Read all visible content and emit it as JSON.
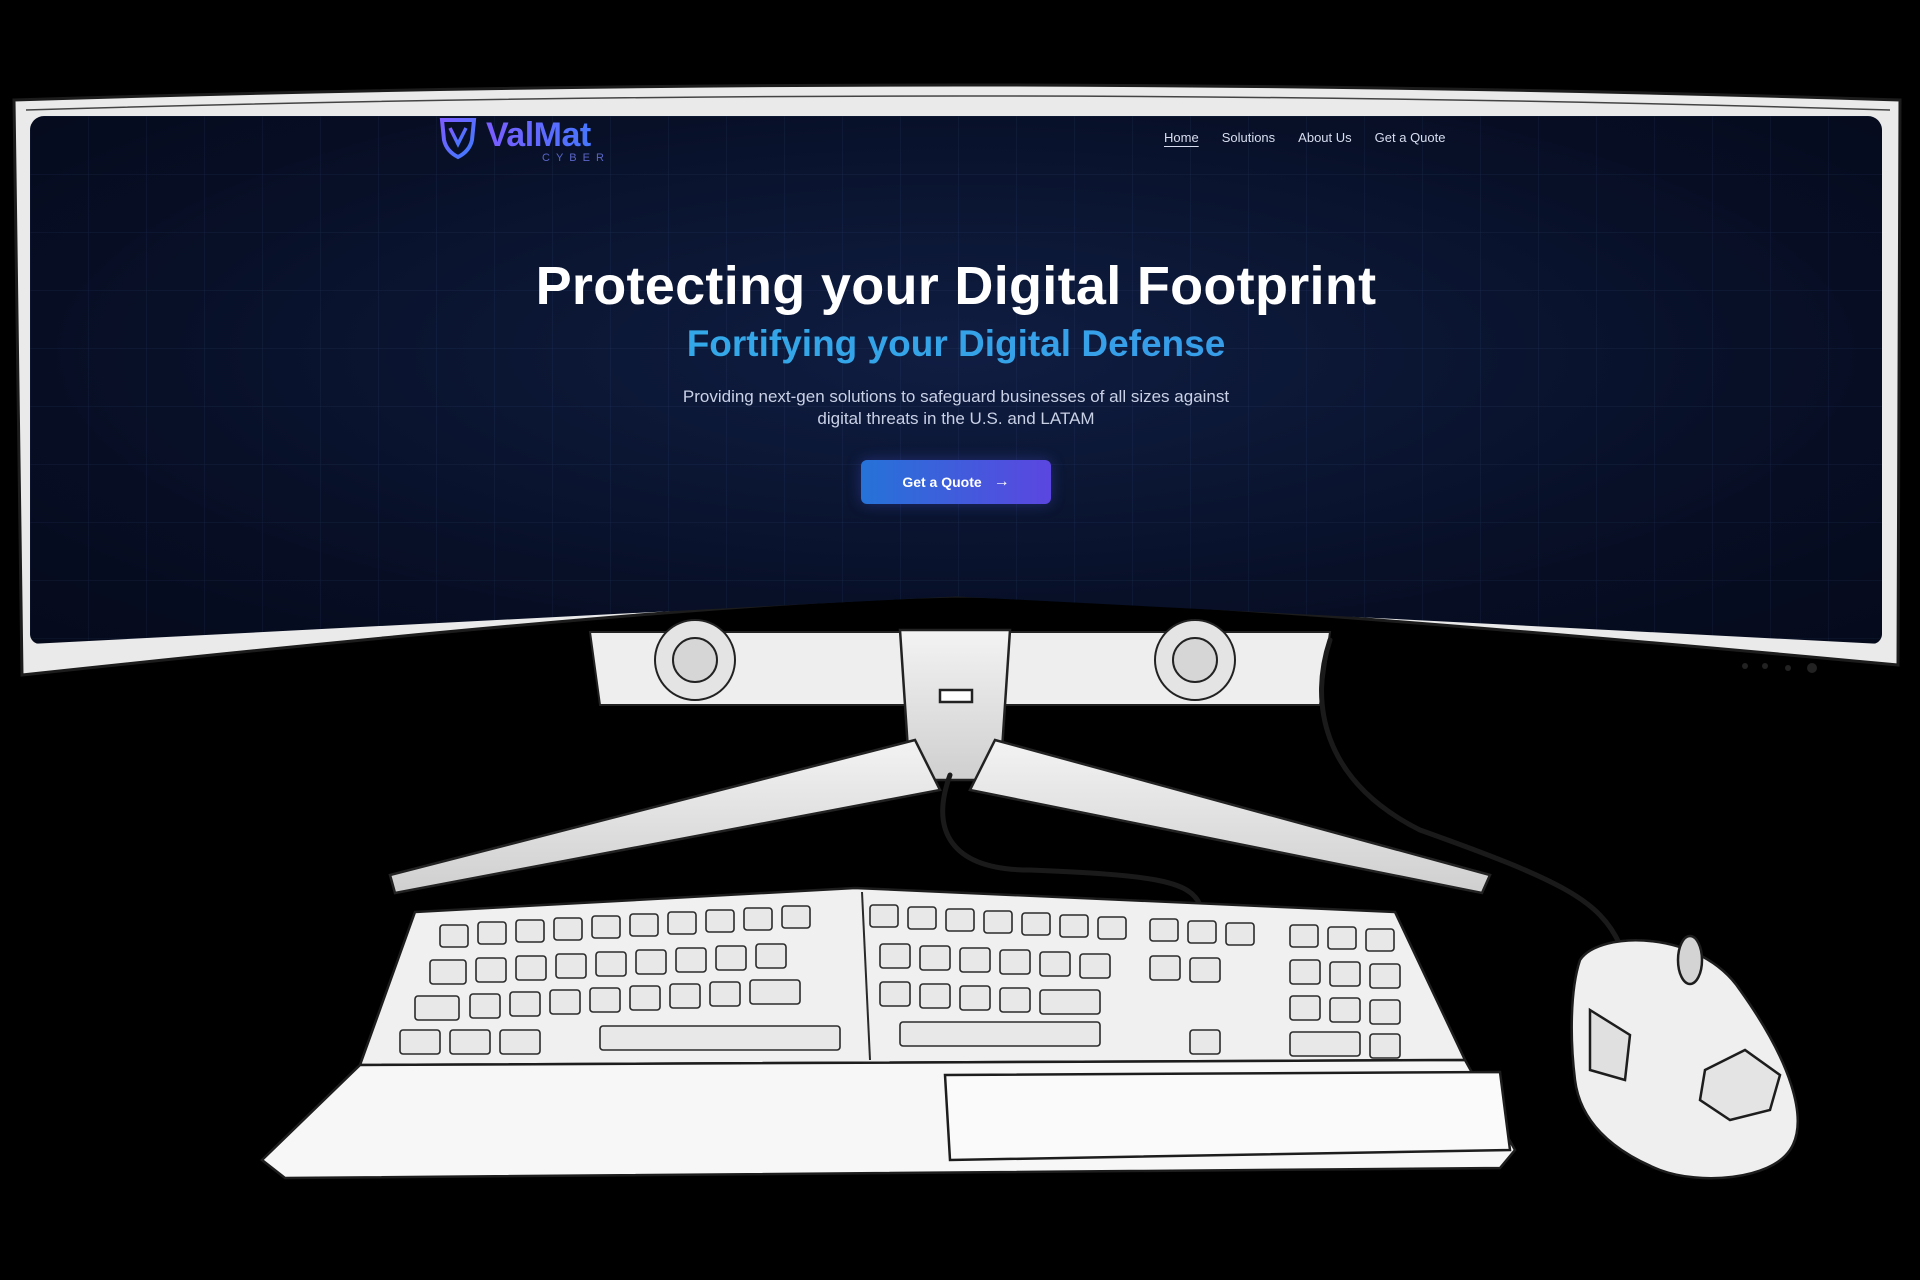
{
  "brand": {
    "name": "ValMat",
    "tagline": "CYBER",
    "colors": {
      "brand_start": "#7b5cff",
      "brand_end": "#3d7bff",
      "accent": "#2fb6ea"
    }
  },
  "nav": {
    "items": [
      {
        "label": "Home",
        "active": true
      },
      {
        "label": "Solutions",
        "active": false
      },
      {
        "label": "About Us",
        "active": false
      },
      {
        "label": "Get a Quote",
        "active": false
      }
    ]
  },
  "hero": {
    "title": "Protecting your Digital Footprint",
    "subtitle": "Fortifying your Digital Defense",
    "description": "Providing next-gen solutions to safeguard businesses of all sizes against digital threats in the U.S. and LATAM",
    "cta_label": "Get a Quote",
    "cta_icon": "arrow-right-icon"
  },
  "icons": {
    "logo": "shield-icon",
    "cta": "arrow-right-icon"
  }
}
